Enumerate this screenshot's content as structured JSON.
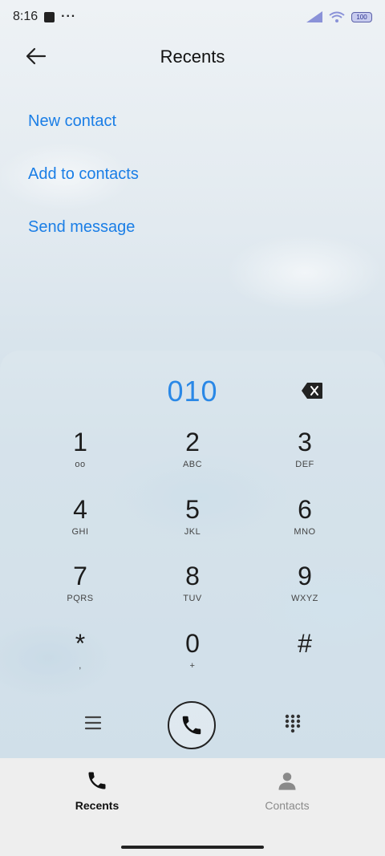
{
  "status_bar": {
    "time": "8:16",
    "battery": "100",
    "icons": [
      "notification-square-icon",
      "more-dots-icon",
      "signal-icon",
      "wifi-icon",
      "battery-icon"
    ]
  },
  "header": {
    "title": "Recents",
    "back_icon": "back-arrow-icon"
  },
  "actions": [
    {
      "label": "New contact"
    },
    {
      "label": "Add to contacts"
    },
    {
      "label": "Send message"
    }
  ],
  "dialer": {
    "number": "010",
    "backspace_icon": "backspace-icon",
    "keys": [
      {
        "digit": "1",
        "letters": "oo"
      },
      {
        "digit": "2",
        "letters": "ABC"
      },
      {
        "digit": "3",
        "letters": "DEF"
      },
      {
        "digit": "4",
        "letters": "GHI"
      },
      {
        "digit": "5",
        "letters": "JKL"
      },
      {
        "digit": "6",
        "letters": "MNO"
      },
      {
        "digit": "7",
        "letters": "PQRS"
      },
      {
        "digit": "8",
        "letters": "TUV"
      },
      {
        "digit": "9",
        "letters": "WXYZ"
      },
      {
        "digit": "*",
        "letters": ","
      },
      {
        "digit": "0",
        "letters": "+"
      },
      {
        "digit": "#",
        "letters": ""
      }
    ],
    "controls": [
      "menu-icon",
      "call-icon",
      "dialpad-grid-icon"
    ]
  },
  "tabs": [
    {
      "label": "Recents",
      "icon": "phone-icon",
      "active": true
    },
    {
      "label": "Contacts",
      "icon": "person-icon",
      "active": false
    }
  ],
  "colors": {
    "accent": "#1a7ee6",
    "number": "#2a88e6",
    "tab_active": "#111111",
    "tab_inactive": "#8a8a8a"
  }
}
